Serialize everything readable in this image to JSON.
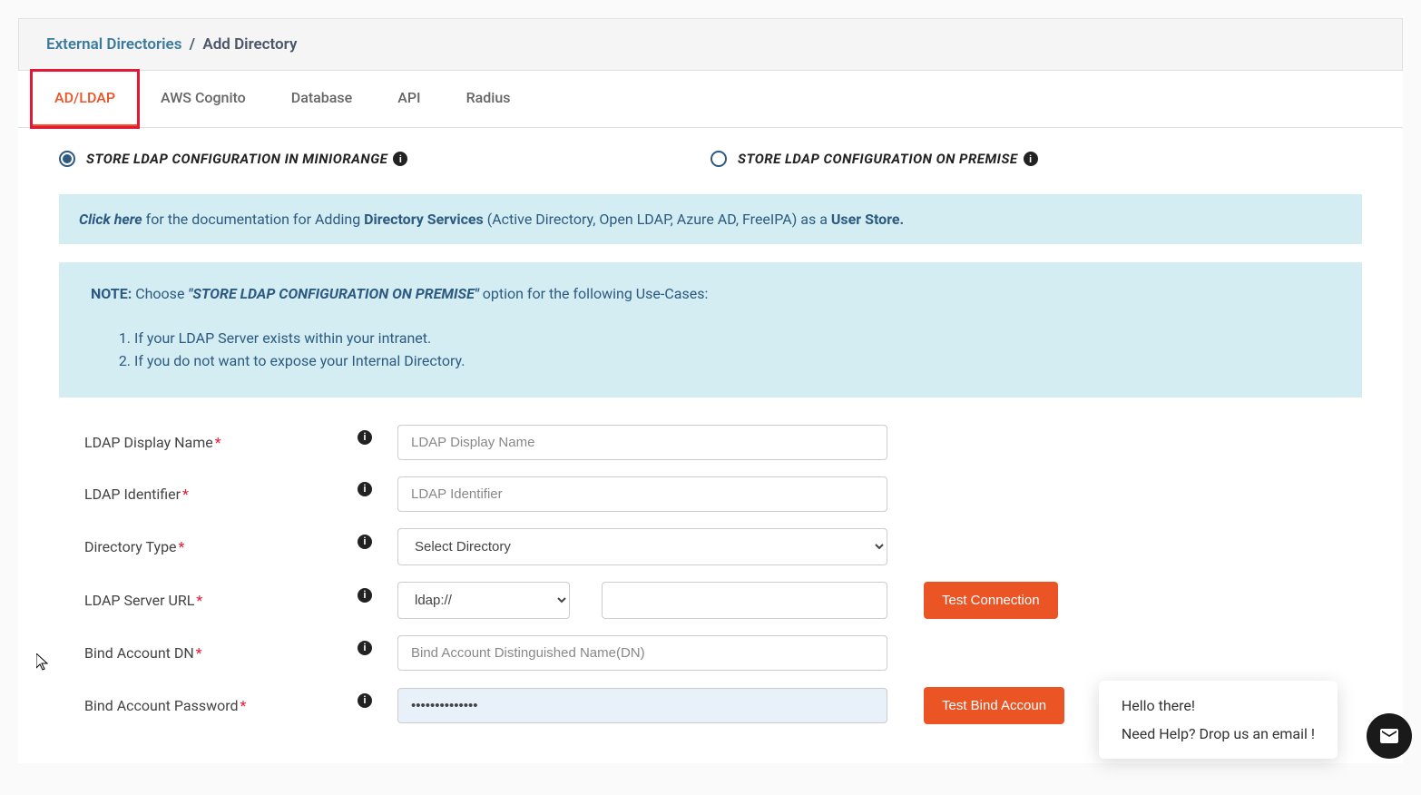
{
  "breadcrumb": {
    "parent": "External Directories",
    "separator": "/",
    "current": "Add Directory"
  },
  "tabs": [
    {
      "label": "AD/LDAP",
      "active": true
    },
    {
      "label": "AWS Cognito",
      "active": false
    },
    {
      "label": "Database",
      "active": false
    },
    {
      "label": "API",
      "active": false
    },
    {
      "label": "Radius",
      "active": false
    }
  ],
  "radios": {
    "miniOrange": "STORE LDAP CONFIGURATION IN MINIORANGE",
    "onPremise": "STORE LDAP CONFIGURATION ON PREMISE"
  },
  "docAlert": {
    "clickHere": "Click here",
    "text1": " for the documentation for Adding ",
    "bold1": "Directory Services",
    "text2": " (Active Directory, Open LDAP, Azure AD, FreeIPA) as a ",
    "bold2": "User Store."
  },
  "noteBox": {
    "noteLabel": "NOTE:",
    "choose": "  Choose ",
    "option": "\"STORE LDAP CONFIGURATION ON PREMISE\"",
    "suffix": " option for the following Use-Cases:",
    "items": [
      "If your LDAP Server exists within your intranet.",
      "If you do not want to expose your Internal Directory."
    ]
  },
  "form": {
    "ldapDisplayName": {
      "label": "LDAP Display Name",
      "placeholder": "LDAP Display Name"
    },
    "ldapIdentifier": {
      "label": "LDAP Identifier",
      "placeholder": "LDAP Identifier"
    },
    "directoryType": {
      "label": "Directory Type",
      "placeholder": "Select Directory"
    },
    "ldapServerUrl": {
      "label": "LDAP Server URL",
      "protocol": "ldap://"
    },
    "bindAccountDn": {
      "label": "Bind Account DN",
      "placeholder": "Bind Account Distinguished Name(DN)"
    },
    "bindAccountPassword": {
      "label": "Bind Account Password",
      "value": "••••••••••••••"
    }
  },
  "buttons": {
    "testConnection": "Test Connection",
    "testBindAccount": "Test Bind Accoun"
  },
  "chat": {
    "greeting": "Hello there!",
    "help": "Need Help? Drop us an email !"
  }
}
